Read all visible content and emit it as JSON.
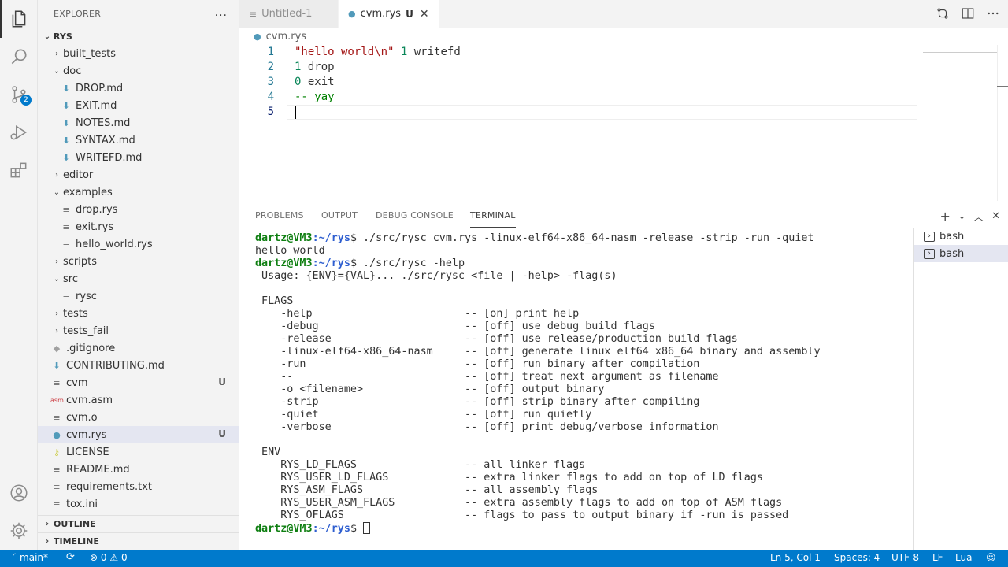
{
  "activity_bar": {
    "items": [
      "explorer",
      "search",
      "source-control",
      "run-and-debug",
      "extensions"
    ],
    "scm_badge": "2",
    "bottom": [
      "accounts",
      "manage"
    ]
  },
  "sidebar": {
    "title": "EXPLORER",
    "more": "...",
    "root": "RYS",
    "tree": [
      {
        "label": "built_tests",
        "type": "folder",
        "open": false
      },
      {
        "label": "doc",
        "type": "folder",
        "open": true
      },
      {
        "label": "DROP.md",
        "type": "md"
      },
      {
        "label": "EXIT.md",
        "type": "md"
      },
      {
        "label": "NOTES.md",
        "type": "md"
      },
      {
        "label": "SYNTAX.md",
        "type": "md"
      },
      {
        "label": "WRITEFD.md",
        "type": "md"
      },
      {
        "label": "editor",
        "type": "folder",
        "open": false
      },
      {
        "label": "examples",
        "type": "folder",
        "open": true
      },
      {
        "label": "drop.rys",
        "type": "file"
      },
      {
        "label": "exit.rys",
        "type": "file"
      },
      {
        "label": "hello_world.rys",
        "type": "file"
      },
      {
        "label": "scripts",
        "type": "folder",
        "open": false
      },
      {
        "label": "src",
        "type": "folder",
        "open": true
      },
      {
        "label": "rysc",
        "type": "file"
      },
      {
        "label": "tests",
        "type": "folder",
        "open": false
      },
      {
        "label": "tests_fail",
        "type": "folder",
        "open": false
      },
      {
        "label": ".gitignore",
        "type": "git"
      },
      {
        "label": "CONTRIBUTING.md",
        "type": "md"
      },
      {
        "label": "cvm",
        "type": "file",
        "status": "U"
      },
      {
        "label": "cvm.asm",
        "type": "asm"
      },
      {
        "label": "cvm.o",
        "type": "file"
      },
      {
        "label": "cvm.rys",
        "type": "rys",
        "status": "U",
        "selected": true
      },
      {
        "label": "LICENSE",
        "type": "license"
      },
      {
        "label": "README.md",
        "type": "file"
      },
      {
        "label": "requirements.txt",
        "type": "file"
      },
      {
        "label": "tox.ini",
        "type": "file"
      }
    ],
    "outline": "OUTLINE",
    "timeline": "TIMELINE"
  },
  "tabs": [
    {
      "label": "Untitled-1",
      "active": false
    },
    {
      "label": "cvm.rys",
      "status": "U",
      "active": true
    }
  ],
  "breadcrumb": "cvm.rys",
  "editor": {
    "lines": [
      {
        "num": "1",
        "parts": [
          {
            "t": "\"hello world\\n\"",
            "c": "str"
          },
          {
            "t": " ",
            "c": ""
          },
          {
            "t": "1",
            "c": "num"
          },
          {
            "t": " writefd",
            "c": ""
          }
        ]
      },
      {
        "num": "2",
        "parts": [
          {
            "t": "1",
            "c": "num"
          },
          {
            "t": " drop",
            "c": ""
          }
        ]
      },
      {
        "num": "3",
        "parts": [
          {
            "t": "0",
            "c": "num"
          },
          {
            "t": " exit",
            "c": ""
          }
        ]
      },
      {
        "num": "4",
        "parts": [
          {
            "t": "-- yay",
            "c": "cmt"
          }
        ]
      },
      {
        "num": "5",
        "parts": []
      }
    ]
  },
  "panel": {
    "tabs": [
      "PROBLEMS",
      "OUTPUT",
      "DEBUG CONSOLE",
      "TERMINAL"
    ],
    "active_tab": "TERMINAL",
    "terminal_lines": [
      {
        "user": "dartz@VM3",
        "path": ":~/rys",
        "cmd": "$ ./src/rysc cvm.rys -linux-elf64-x86_64-nasm -release -strip -run -quiet"
      },
      {
        "text": "hello world"
      },
      {
        "user": "dartz@VM3",
        "path": ":~/rys",
        "cmd": "$ ./src/rysc -help"
      },
      {
        "text": " Usage: {ENV}={VAL}... ./src/rysc <file | -help> -flag(s)"
      },
      {
        "text": ""
      },
      {
        "text": " FLAGS"
      },
      {
        "text": "    -help                        -- [on] print help"
      },
      {
        "text": "    -debug                       -- [off] use debug build flags"
      },
      {
        "text": "    -release                     -- [off] use release/production build flags"
      },
      {
        "text": "    -linux-elf64-x86_64-nasm     -- [off] generate linux elf64 x86_64 binary and assembly"
      },
      {
        "text": "    -run                         -- [off] run binary after compilation"
      },
      {
        "text": "    --                           -- [off] treat next argument as filename"
      },
      {
        "text": "    -o <filename>                -- [off] output binary"
      },
      {
        "text": "    -strip                       -- [off] strip binary after compiling"
      },
      {
        "text": "    -quiet                       -- [off] run quietly"
      },
      {
        "text": "    -verbose                     -- [off] print debug/verbose information"
      },
      {
        "text": ""
      },
      {
        "text": " ENV"
      },
      {
        "text": "    RYS_LD_FLAGS                 -- all linker flags"
      },
      {
        "text": "    RYS_USER_LD_FLAGS            -- extra linker flags to add on top of LD flags"
      },
      {
        "text": "    RYS_ASM_FLAGS                -- all assembly flags"
      },
      {
        "text": "    RYS_USER_ASM_FLAGS           -- extra assembly flags to add on top of ASM flags"
      },
      {
        "text": "    RYS_OFLAGS                   -- flags to pass to output binary if -run is passed"
      },
      {
        "user": "dartz@VM3",
        "path": ":~/rys",
        "cmd": "$ ",
        "cursor": true
      }
    ],
    "terminals": [
      {
        "label": "bash",
        "selected": false
      },
      {
        "label": "bash",
        "selected": true
      }
    ],
    "add": "+",
    "dropdown": "⌄",
    "maximize": "︿",
    "close": "✕"
  },
  "status": {
    "branch": "main*",
    "sync_icon": "⟳",
    "errors": "0",
    "warnings": "0",
    "position": "Ln 5, Col 1",
    "spaces": "Spaces: 4",
    "encoding": "UTF-8",
    "eol": "LF",
    "language": "Lua"
  },
  "colors": {
    "accent": "#007acc",
    "prompt_user": "#0f7f12",
    "prompt_path": "#2f5fd0"
  }
}
